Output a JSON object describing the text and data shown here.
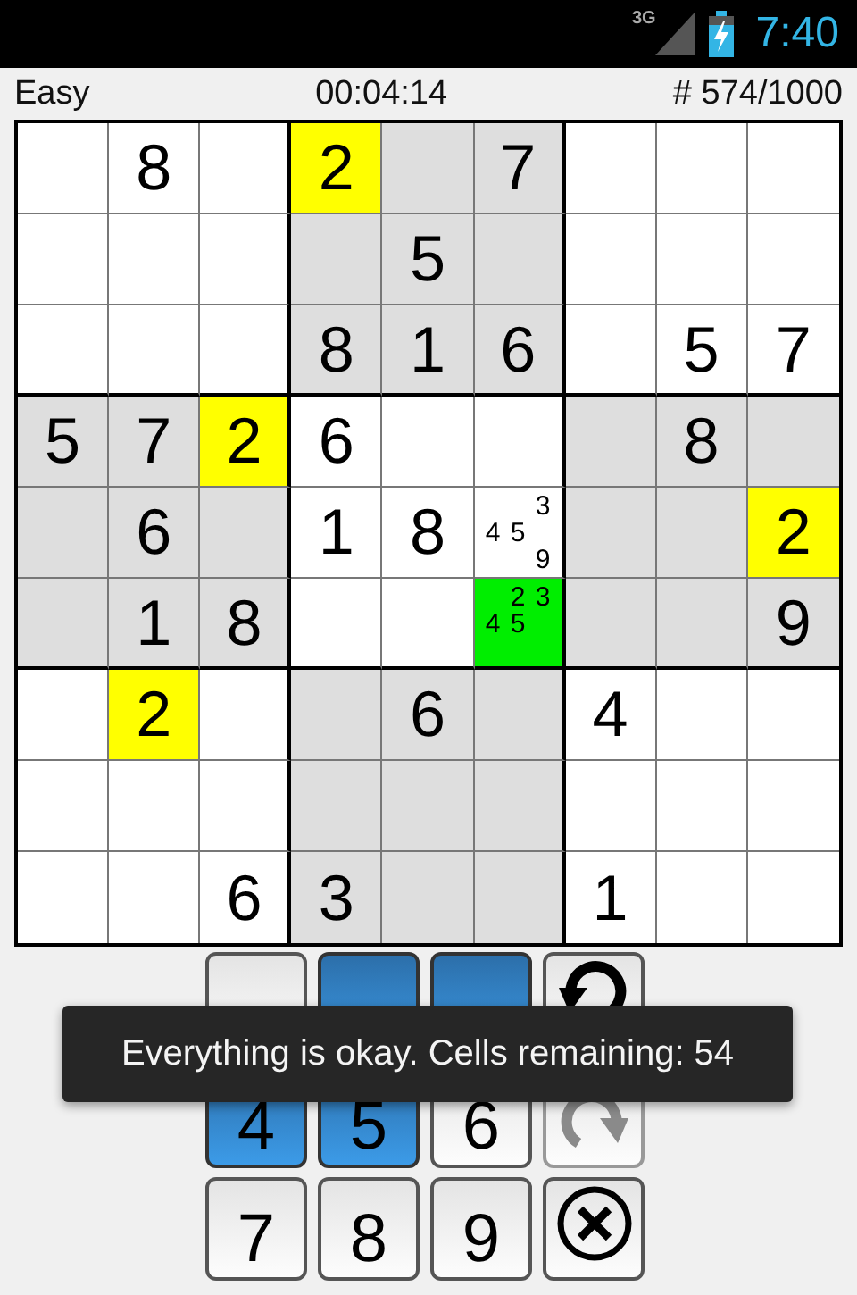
{
  "status_bar": {
    "network": "3G",
    "time": "7:40"
  },
  "header": {
    "difficulty": "Easy",
    "timer": "00:04:14",
    "puzzle_number": "# 574/1000"
  },
  "grid": [
    [
      {
        "selected": false,
        "highlighted": false
      },
      {
        "value": "8",
        "selected": false,
        "highlighted": false
      },
      {
        "selected": false,
        "highlighted": false
      },
      {
        "value": "2",
        "selected": false,
        "highlighted": true
      },
      {
        "selected": false,
        "highlighted": false
      },
      {
        "value": "7",
        "selected": false,
        "highlighted": false
      },
      {
        "selected": false,
        "highlighted": false
      },
      {
        "selected": false,
        "highlighted": false
      },
      {
        "selected": false,
        "highlighted": false
      }
    ],
    [
      {
        "selected": false,
        "highlighted": false
      },
      {
        "selected": false,
        "highlighted": false
      },
      {
        "selected": false,
        "highlighted": false
      },
      {
        "selected": false,
        "highlighted": false
      },
      {
        "value": "5",
        "selected": false,
        "highlighted": false
      },
      {
        "selected": false,
        "highlighted": false
      },
      {
        "selected": false,
        "highlighted": false
      },
      {
        "selected": false,
        "highlighted": false
      },
      {
        "selected": false,
        "highlighted": false
      }
    ],
    [
      {
        "selected": false,
        "highlighted": false
      },
      {
        "selected": false,
        "highlighted": false
      },
      {
        "selected": false,
        "highlighted": false
      },
      {
        "value": "8",
        "selected": false,
        "highlighted": false
      },
      {
        "value": "1",
        "selected": false,
        "highlighted": false
      },
      {
        "value": "6",
        "selected": false,
        "highlighted": false
      },
      {
        "selected": false,
        "highlighted": false
      },
      {
        "value": "5",
        "selected": false,
        "highlighted": false
      },
      {
        "value": "7",
        "selected": false,
        "highlighted": false
      }
    ],
    [
      {
        "value": "5",
        "selected": false,
        "highlighted": false
      },
      {
        "value": "7",
        "selected": false,
        "highlighted": false
      },
      {
        "value": "2",
        "selected": false,
        "highlighted": true
      },
      {
        "value": "6",
        "selected": false,
        "highlighted": false
      },
      {
        "selected": false,
        "highlighted": false
      },
      {
        "selected": false,
        "highlighted": false
      },
      {
        "selected": false,
        "highlighted": false
      },
      {
        "value": "8",
        "selected": false,
        "highlighted": false
      },
      {
        "selected": false,
        "highlighted": false
      }
    ],
    [
      {
        "selected": false,
        "highlighted": false
      },
      {
        "value": "6",
        "selected": false,
        "highlighted": false
      },
      {
        "selected": false,
        "highlighted": false
      },
      {
        "value": "1",
        "selected": false,
        "highlighted": false
      },
      {
        "value": "8",
        "selected": false,
        "highlighted": false
      },
      {
        "notes": [
          "3",
          "4",
          "5",
          "9"
        ],
        "selected": false,
        "highlighted": false
      },
      {
        "selected": false,
        "highlighted": false
      },
      {
        "selected": false,
        "highlighted": false
      },
      {
        "value": "2",
        "selected": false,
        "highlighted": true
      }
    ],
    [
      {
        "selected": false,
        "highlighted": false
      },
      {
        "value": "1",
        "selected": false,
        "highlighted": false
      },
      {
        "value": "8",
        "selected": false,
        "highlighted": false
      },
      {
        "selected": false,
        "highlighted": false
      },
      {
        "selected": false,
        "highlighted": false
      },
      {
        "notes": [
          "2",
          "3",
          "4",
          "5"
        ],
        "selected": true,
        "highlighted": false
      },
      {
        "selected": false,
        "highlighted": false
      },
      {
        "selected": false,
        "highlighted": false
      },
      {
        "value": "9",
        "selected": false,
        "highlighted": false
      }
    ],
    [
      {
        "selected": false,
        "highlighted": false
      },
      {
        "value": "2",
        "selected": false,
        "highlighted": true
      },
      {
        "selected": false,
        "highlighted": false
      },
      {
        "selected": false,
        "highlighted": false
      },
      {
        "value": "6",
        "selected": false,
        "highlighted": false
      },
      {
        "selected": false,
        "highlighted": false
      },
      {
        "value": "4",
        "selected": false,
        "highlighted": false
      },
      {
        "selected": false,
        "highlighted": false
      },
      {
        "selected": false,
        "highlighted": false
      }
    ],
    [
      {
        "selected": false,
        "highlighted": false
      },
      {
        "selected": false,
        "highlighted": false
      },
      {
        "selected": false,
        "highlighted": false
      },
      {
        "selected": false,
        "highlighted": false
      },
      {
        "selected": false,
        "highlighted": false
      },
      {
        "selected": false,
        "highlighted": false
      },
      {
        "selected": false,
        "highlighted": false
      },
      {
        "selected": false,
        "highlighted": false
      },
      {
        "selected": false,
        "highlighted": false
      }
    ],
    [
      {
        "selected": false,
        "highlighted": false
      },
      {
        "selected": false,
        "highlighted": false
      },
      {
        "value": "6",
        "selected": false,
        "highlighted": false
      },
      {
        "value": "3",
        "selected": false,
        "highlighted": false
      },
      {
        "selected": false,
        "highlighted": false
      },
      {
        "selected": false,
        "highlighted": false
      },
      {
        "value": "1",
        "selected": false,
        "highlighted": false
      },
      {
        "selected": false,
        "highlighted": false
      },
      {
        "selected": false,
        "highlighted": false
      }
    ]
  ],
  "keypad": [
    {
      "kind": "digit",
      "selected": false,
      "disabled": false
    },
    {
      "kind": "digit",
      "selected": true,
      "disabled": false
    },
    {
      "kind": "digit",
      "selected": true,
      "disabled": false
    },
    {
      "kind": "undo",
      "selected": false,
      "disabled": false
    },
    {
      "kind": "digit",
      "label": "4",
      "selected": true,
      "disabled": false
    },
    {
      "kind": "digit",
      "label": "5",
      "selected": true,
      "disabled": false
    },
    {
      "kind": "digit",
      "label": "6",
      "selected": false,
      "disabled": false
    },
    {
      "kind": "redo",
      "selected": false,
      "disabled": true
    },
    {
      "kind": "digit",
      "label": "7",
      "selected": false,
      "disabled": false
    },
    {
      "kind": "digit",
      "label": "8",
      "selected": false,
      "disabled": false
    },
    {
      "kind": "digit",
      "label": "9",
      "selected": false,
      "disabled": false
    },
    {
      "kind": "clear",
      "selected": false,
      "disabled": false
    }
  ],
  "toast": {
    "message": "Everything is okay. Cells remaining: 54"
  }
}
